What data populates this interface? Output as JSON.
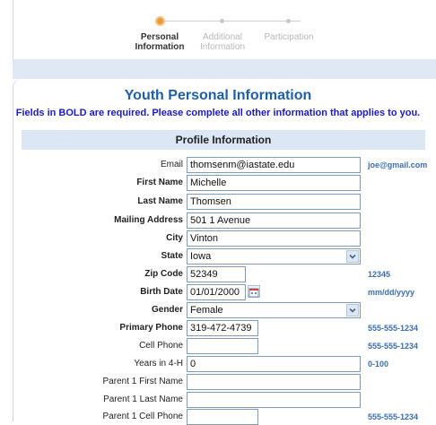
{
  "wizard": {
    "steps": [
      {
        "label_line1": "Personal",
        "label_line2": "Information",
        "state": "active"
      },
      {
        "label_line1": "Additional",
        "label_line2": "Information",
        "state": "inactive"
      },
      {
        "label_line1": "Participation",
        "label_line2": "",
        "state": "inactive"
      }
    ]
  },
  "form": {
    "title": "Youth Personal Information",
    "subtitle": "Fields in BOLD are required. Please complete all other information that applies to you.",
    "section": "Profile Information",
    "fields": {
      "email": {
        "label": "Email",
        "value": "thomsenm@iastate.edu",
        "hint": "joe@gmail.com"
      },
      "first_name": {
        "label": "First Name",
        "value": "Michelle"
      },
      "last_name": {
        "label": "Last Name",
        "value": "Thomsen"
      },
      "mailing_address": {
        "label": "Mailing Address",
        "value": "501 1 Avenue"
      },
      "city": {
        "label": "City",
        "value": "Vinton"
      },
      "state": {
        "label": "State",
        "value": "Iowa"
      },
      "zip": {
        "label": "Zip Code",
        "value": "52349",
        "hint": "12345"
      },
      "birth_date": {
        "label": "Birth Date",
        "value": "01/01/2000",
        "hint": "mm/dd/yyyy"
      },
      "gender": {
        "label": "Gender",
        "value": "Female"
      },
      "primary_phone": {
        "label": "Primary Phone",
        "value": "319-472-4739",
        "hint": "555-555-1234"
      },
      "cell_phone": {
        "label": "Cell Phone",
        "value": "",
        "hint": "555-555-1234"
      },
      "years_4h": {
        "label": "Years in 4-H",
        "value": "0",
        "hint": "0-100"
      },
      "parent1_first": {
        "label": "Parent 1 First Name",
        "value": ""
      },
      "parent1_last": {
        "label": "Parent 1 Last Name",
        "value": ""
      },
      "parent1_cell": {
        "label": "Parent 1 Cell Phone",
        "value": "",
        "hint": "555-555-1234"
      }
    }
  },
  "colors": {
    "accent": "#1e5fa8",
    "hint": "#3a6fb4",
    "active_step": "#f09a34"
  }
}
